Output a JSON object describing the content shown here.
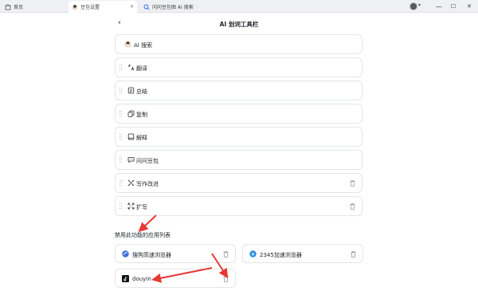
{
  "tabs": [
    {
      "label": "首页",
      "icon": "home-icon"
    },
    {
      "label": "豆包设置",
      "icon": "doubao-avatar-icon"
    },
    {
      "label": "问问豆包图 AI 搜索",
      "icon": "search-icon"
    }
  ],
  "window_controls": [
    "—",
    "☐",
    "✕"
  ],
  "page": {
    "back_glyph": "‹",
    "title": "AI 划词工具栏"
  },
  "toolbar_items": [
    {
      "label": "AI 搜索",
      "icon": "ai-search-avatar-icon",
      "draggable": false,
      "deletable": false
    },
    {
      "label": "翻译",
      "icon": "translate-icon",
      "draggable": true,
      "deletable": false
    },
    {
      "label": "总结",
      "icon": "summary-icon",
      "draggable": true,
      "deletable": false
    },
    {
      "label": "复制",
      "icon": "copy-icon",
      "draggable": true,
      "deletable": false
    },
    {
      "label": "解释",
      "icon": "explain-book-icon",
      "draggable": true,
      "deletable": false
    },
    {
      "label": "问问豆包",
      "icon": "chat-bubble-icon",
      "draggable": true,
      "deletable": false
    },
    {
      "label": "写作改进",
      "icon": "writing-improve-icon",
      "draggable": true,
      "deletable": true
    },
    {
      "label": "扩写",
      "icon": "expand-icon",
      "draggable": true,
      "deletable": true
    }
  ],
  "disabled_section": {
    "title": "禁用此功能的应用列表",
    "apps": [
      {
        "label": "搜狗高速浏览器",
        "icon": "sogou-browser-icon",
        "color": "#3b6fd8"
      },
      {
        "label": "2345加速浏览器",
        "icon": "browser-2345-icon",
        "color": "#2a8de0"
      },
      {
        "label": "douyin",
        "icon": "douyin-icon",
        "color": "#111111"
      }
    ]
  },
  "colors": {
    "annotation_arrow": "#e53935",
    "card_border": "#e3e5e8"
  }
}
